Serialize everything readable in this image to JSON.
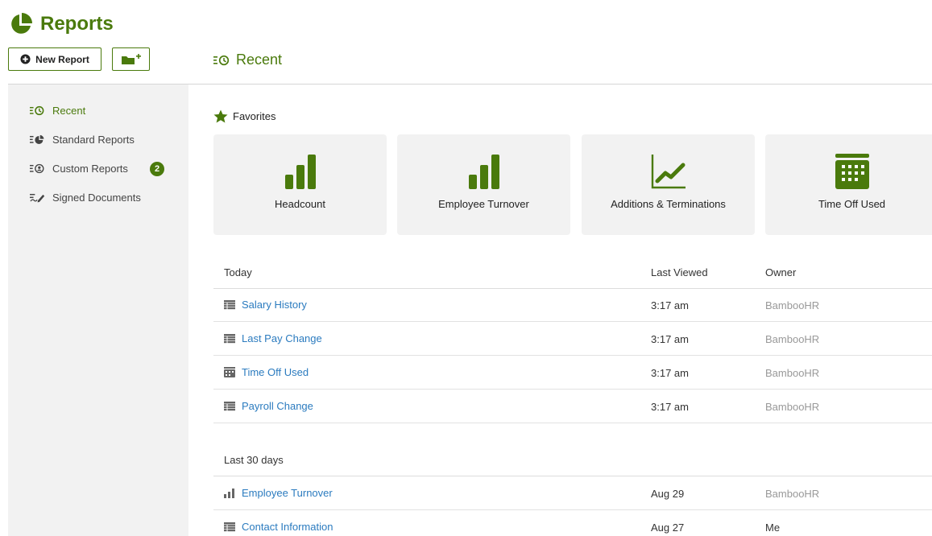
{
  "app": {
    "title": "Reports"
  },
  "toolbar": {
    "new_report_label": "New Report"
  },
  "main": {
    "title": "Recent"
  },
  "sidebar": {
    "items": [
      {
        "label": "Recent",
        "active": true
      },
      {
        "label": "Standard Reports"
      },
      {
        "label": "Custom Reports",
        "badge": "2"
      },
      {
        "label": "Signed Documents"
      }
    ]
  },
  "favorites": {
    "heading": "Favorites",
    "cards": [
      {
        "label": "Headcount",
        "icon": "bar-chart-icon"
      },
      {
        "label": "Employee Turnover",
        "icon": "bar-chart-icon"
      },
      {
        "label": "Additions & Terminations",
        "icon": "line-chart-icon"
      },
      {
        "label": "Time Off Used",
        "icon": "calendar-icon"
      }
    ]
  },
  "columns": {
    "viewed": "Last Viewed",
    "owner": "Owner"
  },
  "groups": [
    {
      "title": "Today",
      "rows": [
        {
          "name": "Salary History",
          "viewed": "3:17 am",
          "owner": "BambooHR",
          "icon": "table-icon"
        },
        {
          "name": "Last Pay Change",
          "viewed": "3:17 am",
          "owner": "BambooHR",
          "icon": "table-icon"
        },
        {
          "name": "Time Off Used",
          "viewed": "3:17 am",
          "owner": "BambooHR",
          "icon": "calendar-icon"
        },
        {
          "name": "Payroll Change",
          "viewed": "3:17 am",
          "owner": "BambooHR",
          "icon": "table-icon"
        }
      ]
    },
    {
      "title": "Last 30 days",
      "rows": [
        {
          "name": "Employee Turnover",
          "viewed": "Aug 29",
          "owner": "BambooHR",
          "icon": "bar-chart-icon"
        },
        {
          "name": "Contact Information",
          "viewed": "Aug 27",
          "owner": "Me",
          "icon": "table-icon"
        }
      ]
    }
  ],
  "colors": {
    "brand": "#4a7a0c",
    "link": "#2b7bbf",
    "muted": "#999999",
    "panel": "#f2f2f2"
  }
}
